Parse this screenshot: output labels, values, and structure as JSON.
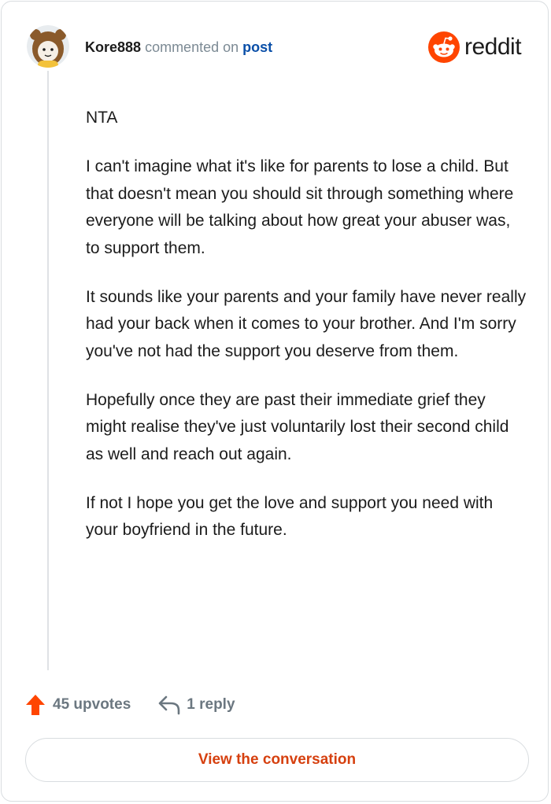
{
  "header": {
    "username": "Kore888",
    "action_text": "commented on",
    "post_link_label": "post",
    "brand_name": "reddit",
    "avatar_icon": "avatar-icon",
    "logo_icon": "reddit-snoo-icon"
  },
  "comment": {
    "paragraphs": [
      "NTA",
      "I can't imagine what it's like for parents to lose a child. But that doesn't mean you should sit through something where everyone will be talking about how great your abuser was, to support them.",
      "It sounds like your parents and your family have never really had your back when it comes to your brother. And I'm sorry you've not had the support you deserve from them.",
      "Hopefully once they are past their immediate grief they might realise they've just voluntarily lost their second child as well and reach out again.",
      "If not I hope you get the love and support you need with your boyfriend in the future."
    ]
  },
  "footer": {
    "upvotes_label": "45 upvotes",
    "replies_label": "1 reply",
    "view_conversation_label": "View the conversation",
    "upvote_icon": "upvote-arrow-icon",
    "reply_icon": "reply-arrow-icon"
  },
  "colors": {
    "accent": "#ff4500",
    "link": "#0a4fa8",
    "muted": "#7c8a94",
    "button_text": "#d6400f"
  }
}
